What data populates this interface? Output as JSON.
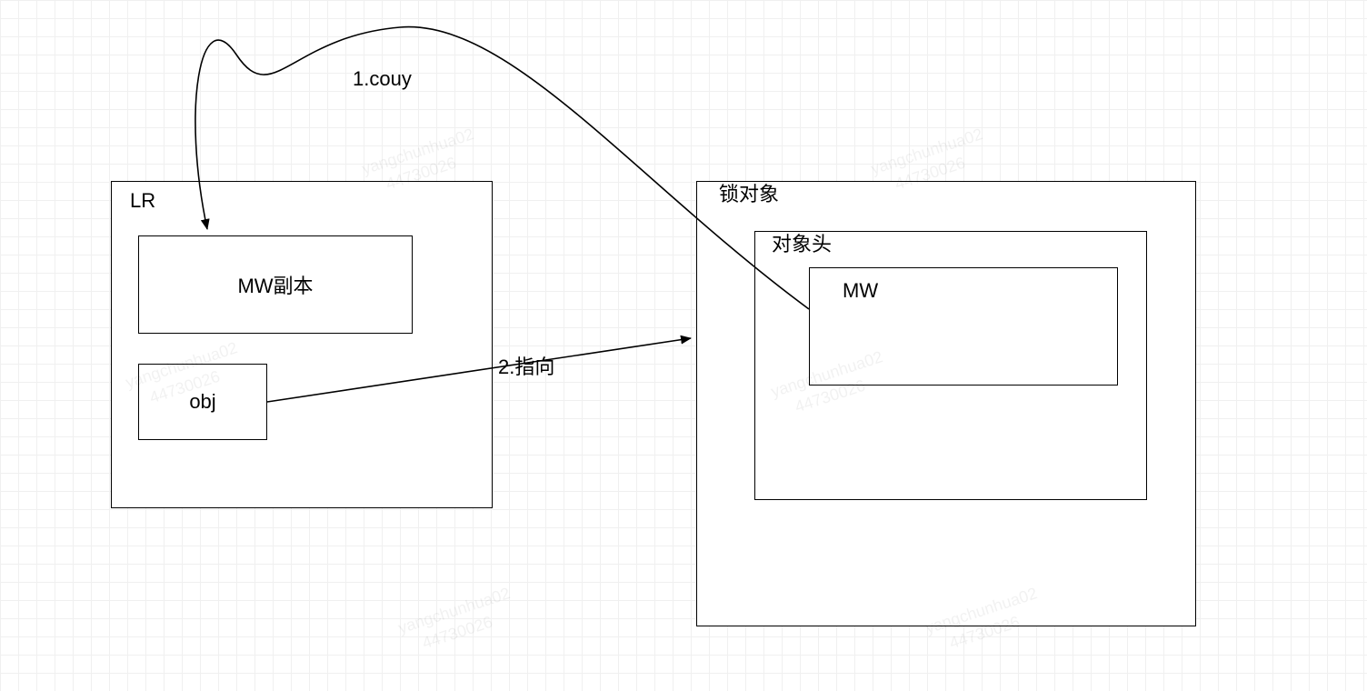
{
  "arrows": {
    "copy_label": "1.couy",
    "point_label": "2.指向"
  },
  "left_box": {
    "title": "LR",
    "mw_copy": "MW副本",
    "obj": "obj"
  },
  "right_box": {
    "title": "锁对象",
    "header": "对象头",
    "mw": "MW"
  },
  "watermark": {
    "line1": "yangchunhua02",
    "line2": "44730026"
  }
}
